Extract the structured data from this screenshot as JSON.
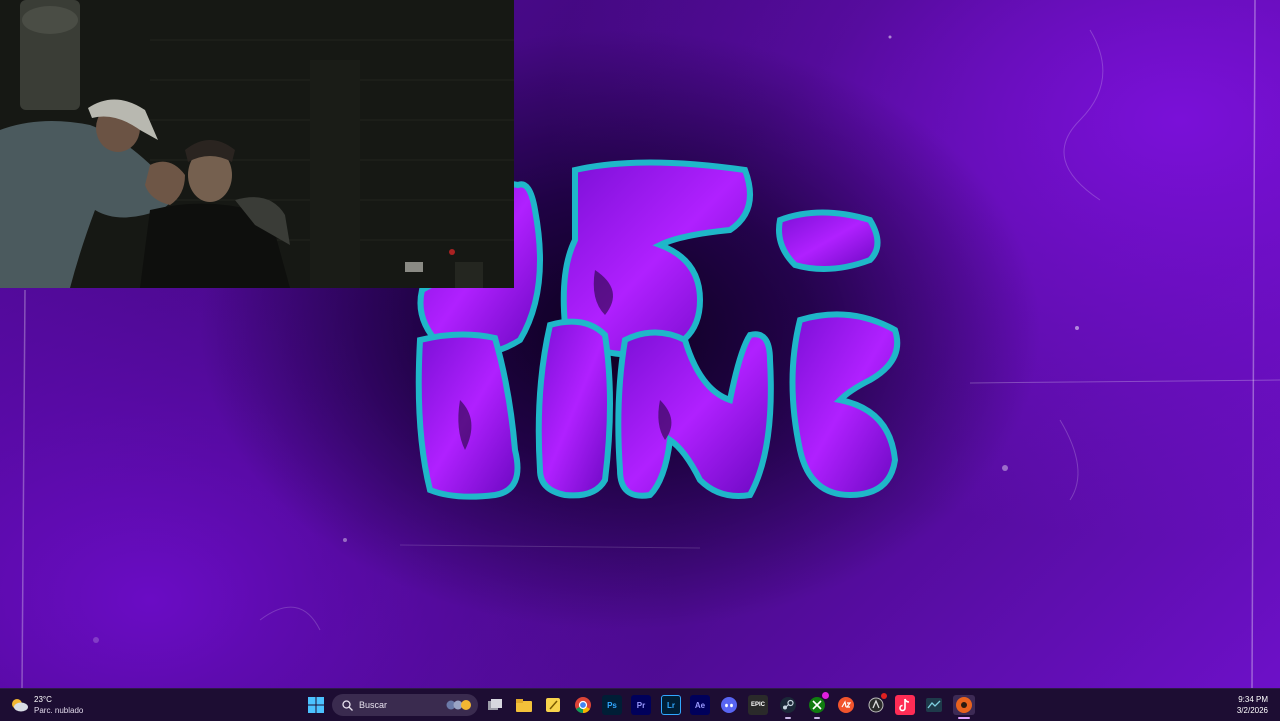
{
  "taskbar": {
    "weather": {
      "temp": "23°C",
      "condition": "Parc. nublado"
    },
    "search": {
      "placeholder": "Buscar"
    },
    "clock": {
      "time": "9:34 PM",
      "date": "3/2/2026"
    },
    "apps": [
      {
        "name": "windows-start",
        "label": ""
      },
      {
        "name": "file-explorer",
        "label": ""
      },
      {
        "name": "chrome",
        "label": ""
      },
      {
        "name": "photoshop",
        "label": "Ps"
      },
      {
        "name": "premiere",
        "label": "Pr"
      },
      {
        "name": "lightroom",
        "label": "Lr"
      },
      {
        "name": "after-effects",
        "label": "Ae"
      },
      {
        "name": "discord",
        "label": ""
      },
      {
        "name": "epic-games",
        "label": "EPIC"
      },
      {
        "name": "steam",
        "label": ""
      },
      {
        "name": "xbox",
        "label": ""
      },
      {
        "name": "ea",
        "label": ""
      },
      {
        "name": "tiktok",
        "label": ""
      },
      {
        "name": "obs",
        "label": ""
      }
    ]
  },
  "colors": {
    "taskbar_bg": "#1d0d33",
    "wallpaper_purple": "#6a0cc4",
    "logo_fill": "#9a18e8",
    "logo_outline": "#1fb7c9"
  }
}
